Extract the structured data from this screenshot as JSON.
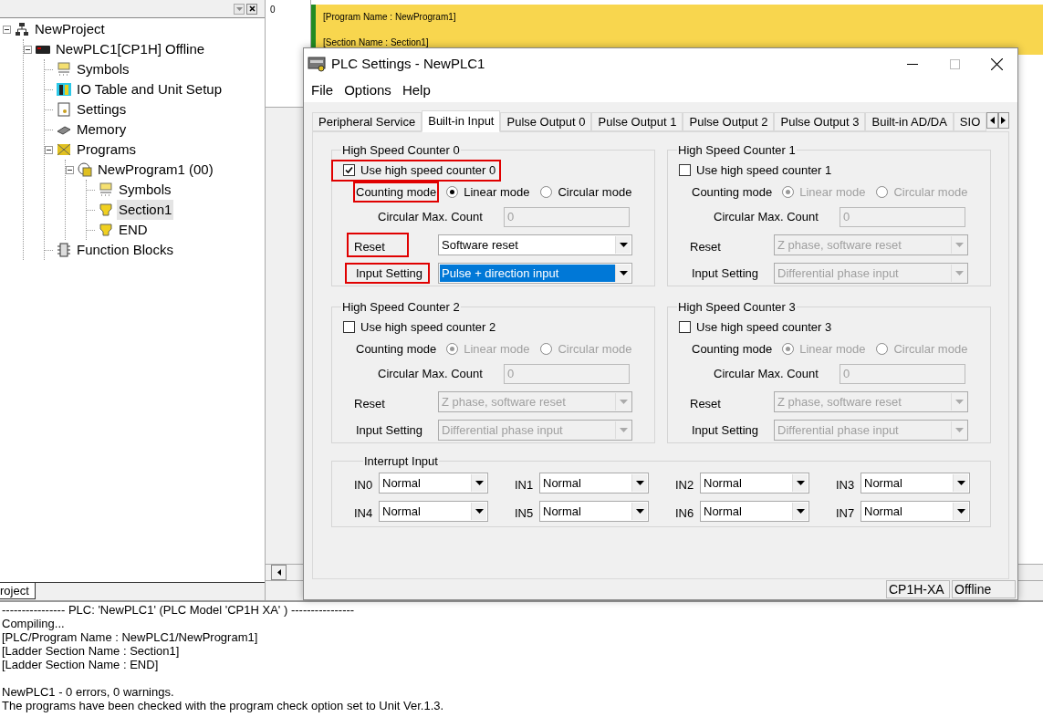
{
  "project_tree": {
    "tab": "roject",
    "items": [
      {
        "label": "NewProject",
        "kind": "network",
        "expanded": true,
        "selected": false,
        "children": [
          {
            "label": "NewPLC1[CP1H] Offline",
            "kind": "plc",
            "expanded": true,
            "selected": false,
            "children": [
              {
                "label": "Symbols",
                "kind": "symbols",
                "selected": false
              },
              {
                "label": "IO Table and Unit Setup",
                "kind": "io",
                "selected": false
              },
              {
                "label": "Settings",
                "kind": "settings",
                "selected": false
              },
              {
                "label": "Memory",
                "kind": "chip",
                "selected": false
              },
              {
                "label": "Programs",
                "kind": "programs",
                "expanded": true,
                "selected": false,
                "children": [
                  {
                    "label": "NewProgram1 (00)",
                    "kind": "program",
                    "expanded": true,
                    "selected": false,
                    "children": [
                      {
                        "label": "Symbols",
                        "kind": "symbols",
                        "selected": false
                      },
                      {
                        "label": "Section1",
                        "kind": "section",
                        "selected": true
                      },
                      {
                        "label": "END",
                        "kind": "section",
                        "selected": false
                      }
                    ]
                  }
                ]
              },
              {
                "label": "Function Blocks",
                "kind": "blocks",
                "selected": false
              }
            ]
          }
        ]
      }
    ]
  },
  "ladder": {
    "rung_number": "0",
    "comments": [
      "[Program Name : NewProgram1]",
      "[Section Name : Section1]"
    ]
  },
  "dialog": {
    "title": "PLC Settings - NewPLC1",
    "menu": [
      "File",
      "Options",
      "Help"
    ],
    "tabs": [
      {
        "label": "Peripheral Service",
        "selected": false
      },
      {
        "label": "Built-in Input",
        "selected": true
      },
      {
        "label": "Pulse Output 0",
        "selected": false
      },
      {
        "label": "Pulse Output 1",
        "selected": false
      },
      {
        "label": "Pulse Output 2",
        "selected": false
      },
      {
        "label": "Pulse Output 3",
        "selected": false
      },
      {
        "label": "Built-in AD/DA",
        "selected": false
      },
      {
        "label": "SIO",
        "selected": false
      }
    ],
    "counters": [
      {
        "title": "High Speed Counter 0",
        "use_label": "Use high speed counter 0",
        "checked": true,
        "enabled": true,
        "annotated": true,
        "mode_label": "Counting mode",
        "modes": [
          {
            "label": "Linear mode",
            "selected": true
          },
          {
            "label": "Circular mode",
            "selected": false
          }
        ],
        "max_label": "Circular Max. Count",
        "max_value": "0",
        "reset_label": "Reset",
        "reset_value": "Software reset",
        "input_label": "Input Setting",
        "input_value": "Pulse + direction input",
        "input_focused": true
      },
      {
        "title": "High Speed Counter 1",
        "use_label": "Use high speed counter 1",
        "checked": false,
        "enabled": false,
        "annotated": false,
        "mode_label": "Counting mode",
        "modes": [
          {
            "label": "Linear mode",
            "selected": true
          },
          {
            "label": "Circular mode",
            "selected": false
          }
        ],
        "max_label": "Circular Max. Count",
        "max_value": "0",
        "reset_label": "Reset",
        "reset_value": "Z phase, software reset",
        "input_label": "Input Setting",
        "input_value": "Differential phase input",
        "input_focused": false
      },
      {
        "title": "High Speed Counter 2",
        "use_label": "Use high speed counter 2",
        "checked": false,
        "enabled": false,
        "annotated": false,
        "mode_label": "Counting mode",
        "modes": [
          {
            "label": "Linear mode",
            "selected": true
          },
          {
            "label": "Circular mode",
            "selected": false
          }
        ],
        "max_label": "Circular Max. Count",
        "max_value": "0",
        "reset_label": "Reset",
        "reset_value": "Z phase, software reset",
        "input_label": "Input Setting",
        "input_value": "Differential phase input",
        "input_focused": false
      },
      {
        "title": "High Speed Counter 3",
        "use_label": "Use high speed counter 3",
        "checked": false,
        "enabled": false,
        "annotated": false,
        "mode_label": "Counting mode",
        "modes": [
          {
            "label": "Linear mode",
            "selected": true
          },
          {
            "label": "Circular mode",
            "selected": false
          }
        ],
        "max_label": "Circular Max. Count",
        "max_value": "0",
        "reset_label": "Reset",
        "reset_value": "Z phase, software reset",
        "input_label": "Input Setting",
        "input_value": "Differential phase input",
        "input_focused": false
      }
    ],
    "interrupt": {
      "title": "Interrupt Input",
      "inputs": [
        {
          "label": "IN0",
          "value": "Normal"
        },
        {
          "label": "IN1",
          "value": "Normal"
        },
        {
          "label": "IN2",
          "value": "Normal"
        },
        {
          "label": "IN3",
          "value": "Normal"
        },
        {
          "label": "IN4",
          "value": "Normal"
        },
        {
          "label": "IN5",
          "value": "Normal"
        },
        {
          "label": "IN6",
          "value": "Normal"
        },
        {
          "label": "IN7",
          "value": "Normal"
        }
      ]
    },
    "status": [
      "CP1H-XA",
      "Offline"
    ]
  },
  "output": {
    "blocks": [
      [
        "---------------- PLC: 'NewPLC1' (PLC Model 'CP1H XA' ) ----------------",
        "Compiling...",
        "[PLC/Program Name : NewPLC1/NewProgram1]",
        "[Ladder Section Name : Section1]",
        "[Ladder Section Name : END]"
      ],
      [
        "NewPLC1 - 0 errors, 0 warnings.",
        "The programs have been checked with the program check option set to Unit Ver.1.3."
      ]
    ]
  }
}
